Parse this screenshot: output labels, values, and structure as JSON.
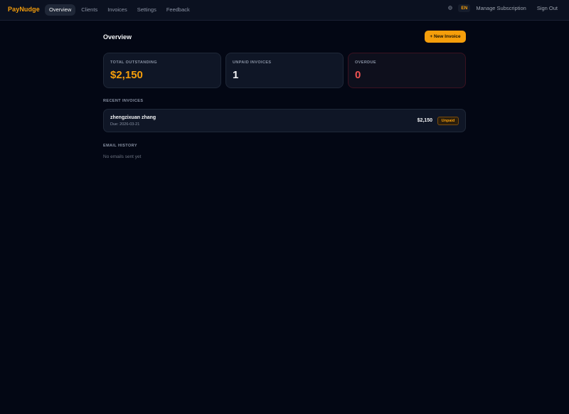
{
  "nav": {
    "brand": "PayNudge",
    "items": [
      {
        "label": "Overview",
        "active": true
      },
      {
        "label": "Clients"
      },
      {
        "label": "Invoices"
      },
      {
        "label": "Settings"
      },
      {
        "label": "Feedback"
      }
    ],
    "globe_icon": "globe-icon",
    "language": "EN",
    "manage_subscription": "Manage Subscription",
    "sign_out": "Sign Out"
  },
  "overview": {
    "title": "Overview",
    "new_invoice_label": "+ New Invoice"
  },
  "stats": [
    {
      "label": "TOTAL OUTSTANDING",
      "value": "$2,150",
      "color": "#f59e0b"
    },
    {
      "label": "UNPAID INVOICES",
      "value": "1",
      "color": "#f3f4f6"
    },
    {
      "label": "OVERDUE",
      "value": "0",
      "color": "#f05252"
    }
  ],
  "recent_invoices": {
    "title": "RECENT INVOICES",
    "items": [
      {
        "client": "zhengzixuan zhang",
        "due": "Due: 2026-03-21",
        "amount": "$2,150",
        "status": "Unpaid"
      }
    ]
  },
  "email_history": {
    "title": "EMAIL HISTORY",
    "empty": "No emails sent yet"
  },
  "colors": {
    "accent": "#f59e0b",
    "background": "#030714",
    "danger": "#f05252"
  }
}
